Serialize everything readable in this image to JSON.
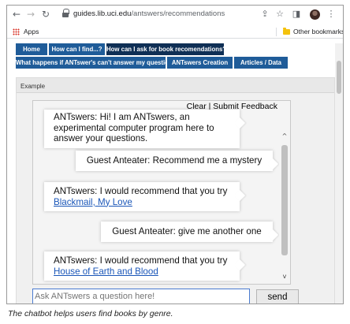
{
  "browser": {
    "url_host": "guides.lib.uci.edu",
    "url_path": "/antswers/recommendations",
    "bookmarks": {
      "apps_label": "Apps",
      "other_label": "Other bookmarks"
    }
  },
  "nav": {
    "tabs": [
      {
        "label": "Home"
      },
      {
        "label": "How can I find...?"
      },
      {
        "label": "How can I ask for book recomendations?"
      },
      {
        "label": "What happens if ANTswer's can't answer my question?"
      },
      {
        "label": "ANTswers Creation"
      },
      {
        "label": "Articles / Data"
      }
    ],
    "active_tab": "How can I ask for book recomendations?",
    "colors": {
      "tab": "#1f5c99",
      "active_tab": "#0f2f55"
    }
  },
  "example": {
    "label": "Example",
    "chat": {
      "clear_label": "Clear",
      "separator": "|",
      "feedback_label": "Submit Feedback",
      "messages": [
        {
          "sender": "bot",
          "text": "ANTswers: Hi! I am ANTswers, an experimental computer program here to answer your questions."
        },
        {
          "sender": "user",
          "text": "Guest Anteater: Recommend me a mystery"
        },
        {
          "sender": "bot",
          "text": "ANTswers: I would recommend that you try",
          "link": "Blackmail, My Love"
        },
        {
          "sender": "user",
          "text": "Guest Anteater: give me another one"
        },
        {
          "sender": "bot",
          "text": "ANTswers: I would recommend that you try",
          "link": "House of Earth and Blood"
        }
      ],
      "input_placeholder": "Ask ANTswers a question here!",
      "send_label": "send"
    }
  },
  "caption": "The chatbot helps users find books by genre."
}
